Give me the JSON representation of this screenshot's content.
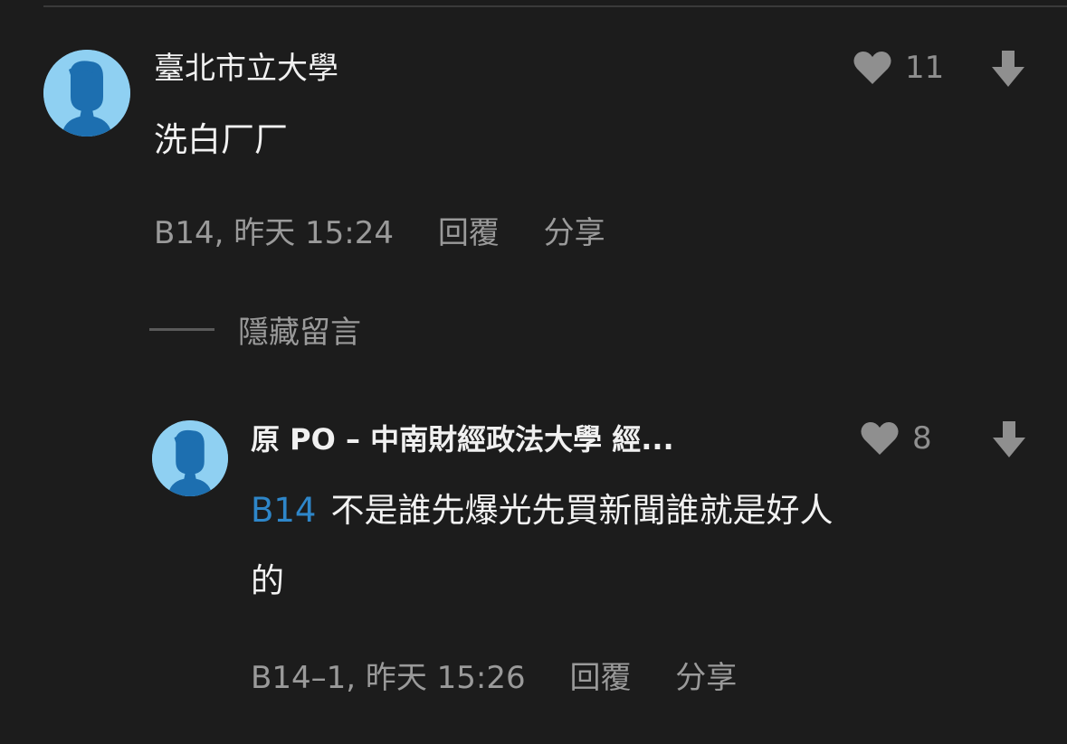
{
  "comment": {
    "author": "臺北市立大學",
    "text": "洗白厂厂",
    "floor_time": "B14, 昨天 15:24",
    "reply_label": "回覆",
    "share_label": "分享",
    "like_count": "11",
    "avatar_icon": "user-avatar-icon",
    "like_icon": "heart-icon",
    "dislike_icon": "arrow-down-icon"
  },
  "hide_comments_label": "隱藏留言",
  "reply": {
    "author": "原 PO – 中南財經政法大學 經...",
    "mention": "B14",
    "text_line1": "不是誰先爆光先買新聞誰就是好人",
    "text_line2": "的",
    "floor_time": "B14–1, 昨天 15:26",
    "reply_label": "回覆",
    "share_label": "分享",
    "like_count": "8",
    "avatar_icon": "user-avatar-icon",
    "like_icon": "heart-icon",
    "dislike_icon": "arrow-down-icon"
  },
  "colors": {
    "background": "#1c1c1c",
    "avatar_bg": "#8fd0f2",
    "avatar_figure": "#1d6fb0",
    "mention": "#2e86c9",
    "meta_text": "#9a9a9a",
    "icon": "#8f8f8f"
  }
}
